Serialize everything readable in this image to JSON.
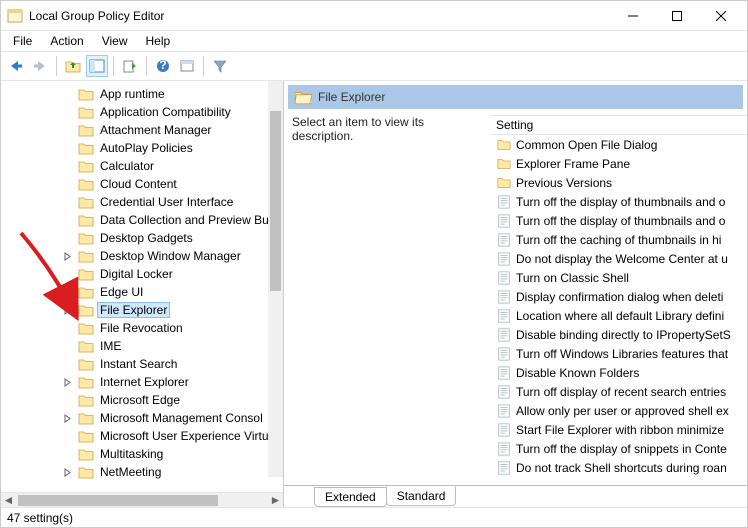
{
  "window": {
    "title": "Local Group Policy Editor"
  },
  "menu": {
    "file": "File",
    "action": "Action",
    "view": "View",
    "help": "Help"
  },
  "tree": {
    "items": [
      {
        "label": "App runtime",
        "exp": false
      },
      {
        "label": "Application Compatibility",
        "exp": false
      },
      {
        "label": "Attachment Manager",
        "exp": false
      },
      {
        "label": "AutoPlay Policies",
        "exp": false
      },
      {
        "label": "Calculator",
        "exp": false
      },
      {
        "label": "Cloud Content",
        "exp": false
      },
      {
        "label": "Credential User Interface",
        "exp": false
      },
      {
        "label": "Data Collection and Preview Bu",
        "exp": false
      },
      {
        "label": "Desktop Gadgets",
        "exp": false
      },
      {
        "label": "Desktop Window Manager",
        "exp": true
      },
      {
        "label": "Digital Locker",
        "exp": false
      },
      {
        "label": "Edge UI",
        "exp": false
      },
      {
        "label": "File Explorer",
        "exp": true,
        "selected": true
      },
      {
        "label": "File Revocation",
        "exp": false
      },
      {
        "label": "IME",
        "exp": false
      },
      {
        "label": "Instant Search",
        "exp": false
      },
      {
        "label": "Internet Explorer",
        "exp": true
      },
      {
        "label": "Microsoft Edge",
        "exp": false
      },
      {
        "label": "Microsoft Management Consol",
        "exp": true
      },
      {
        "label": "Microsoft User Experience Virtu",
        "exp": false
      },
      {
        "label": "Multitasking",
        "exp": false
      },
      {
        "label": "NetMeeting",
        "exp": true
      }
    ]
  },
  "right": {
    "header": "File Explorer",
    "desc": "Select an item to view its description.",
    "column": "Setting",
    "items": [
      {
        "type": "folder",
        "label": "Common Open File Dialog"
      },
      {
        "type": "folder",
        "label": "Explorer Frame Pane"
      },
      {
        "type": "folder",
        "label": "Previous Versions"
      },
      {
        "type": "policy",
        "label": "Turn off the display of thumbnails and o"
      },
      {
        "type": "policy",
        "label": "Turn off the display of thumbnails and o"
      },
      {
        "type": "policy",
        "label": "Turn off the caching of thumbnails in hi"
      },
      {
        "type": "policy",
        "label": "Do not display the Welcome Center at u"
      },
      {
        "type": "policy",
        "label": "Turn on Classic Shell"
      },
      {
        "type": "policy",
        "label": "Display confirmation dialog when deleti"
      },
      {
        "type": "policy",
        "label": "Location where all default Library defini"
      },
      {
        "type": "policy",
        "label": "Disable binding directly to IPropertySetS"
      },
      {
        "type": "policy",
        "label": "Turn off Windows Libraries features that"
      },
      {
        "type": "policy",
        "label": "Disable Known Folders"
      },
      {
        "type": "policy",
        "label": "Turn off display of recent search entries"
      },
      {
        "type": "policy",
        "label": "Allow only per user or approved shell ex"
      },
      {
        "type": "policy",
        "label": "Start File Explorer with ribbon minimize"
      },
      {
        "type": "policy",
        "label": "Turn off the display of snippets in Conte"
      },
      {
        "type": "policy",
        "label": "Do not track Shell shortcuts during roan"
      }
    ],
    "tabs": {
      "extended": "Extended",
      "standard": "Standard"
    }
  },
  "status": {
    "text": "47 setting(s)"
  }
}
